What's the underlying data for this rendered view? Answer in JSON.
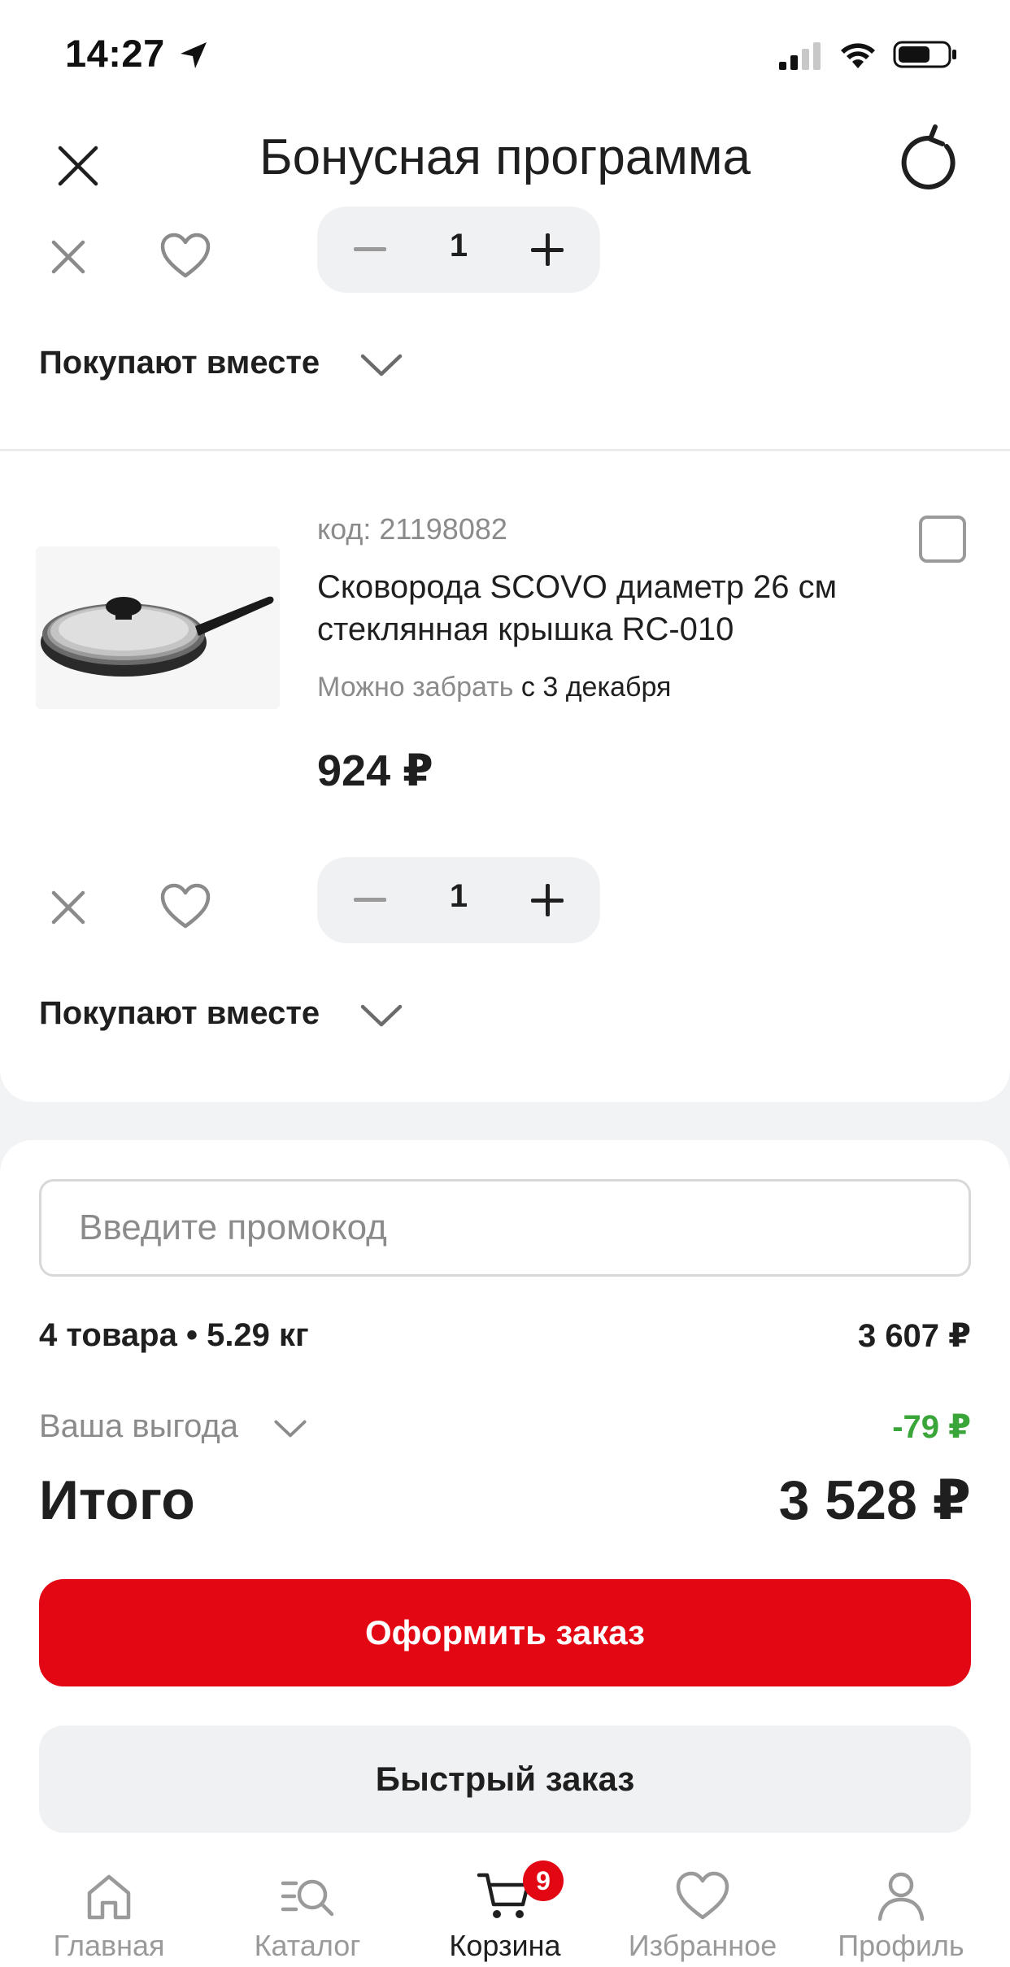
{
  "status_bar": {
    "time": "14:27"
  },
  "header": {
    "title": "Бонусная программа"
  },
  "item_top": {
    "quantity": "1",
    "buy_together_label": "Покупают вместе"
  },
  "item": {
    "code": "код: 21198082",
    "name": "Сковорода SCOVO диаметр 26 см стеклянная крышка RC-010",
    "pickup_label": "Можно забрать",
    "pickup_date": "с 3 декабря",
    "price": "924 ₽",
    "quantity": "1",
    "buy_together_label": "Покупают вместе"
  },
  "summary": {
    "promo_placeholder": "Введите промокод",
    "items_summary": "4 товара • 5.29 кг",
    "items_total": "3 607 ₽",
    "benefit_label": "Ваша выгода",
    "benefit_value": "-79 ₽",
    "total_label": "Итого",
    "total_value": "3 528 ₽",
    "order_button": "Оформить заказ",
    "quick_order_button": "Быстрый заказ"
  },
  "tabbar": {
    "tabs": [
      {
        "label": "Главная"
      },
      {
        "label": "Каталог"
      },
      {
        "label": "Корзина"
      },
      {
        "label": "Избранное"
      },
      {
        "label": "Профиль"
      }
    ],
    "cart_badge": "9"
  },
  "colors": {
    "accent": "#e30613",
    "benefit": "#3aa63a",
    "muted": "#8b8b8b"
  }
}
